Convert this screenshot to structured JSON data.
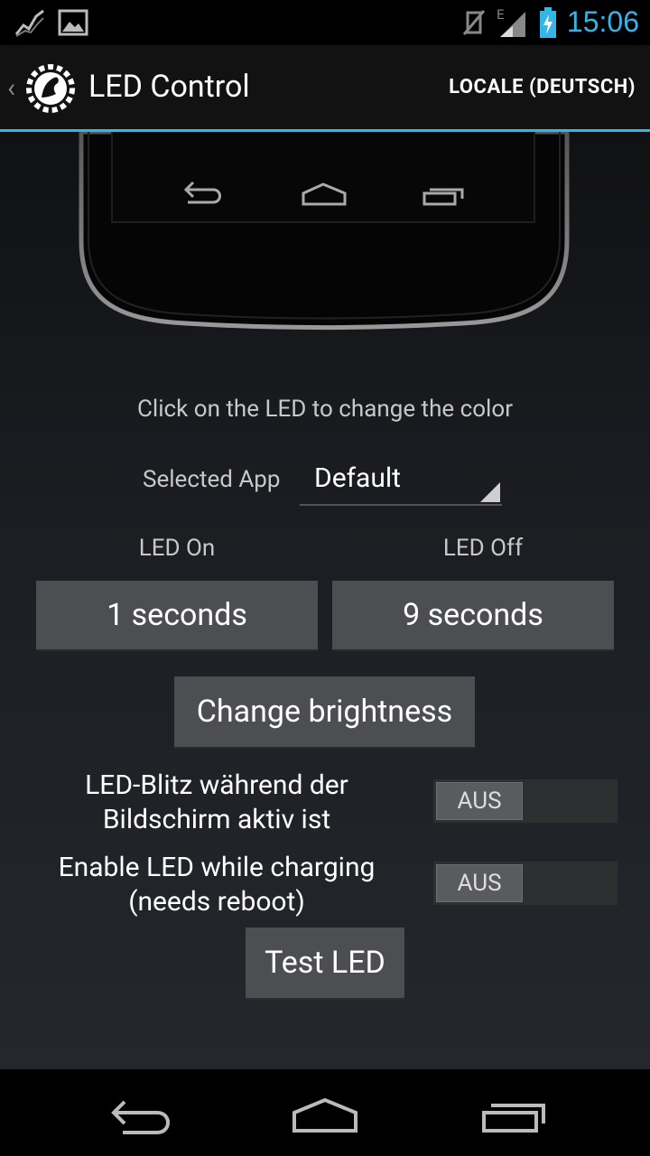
{
  "status_bar": {
    "time": "15:06",
    "network_type": "E",
    "icons": [
      "activity-graph-icon",
      "image-icon",
      "vibrate-muted-icon",
      "signal-icon",
      "battery-charging-icon"
    ]
  },
  "action_bar": {
    "title": "LED Control",
    "locale_button": "LOCALE (DEUTSCH)",
    "accent_color": "#33b5e5"
  },
  "main": {
    "hint": "Click on the LED to change the color",
    "selected_app_label": "Selected App",
    "selected_app_value": "Default",
    "led_on_label": "LED On",
    "led_off_label": "LED Off",
    "led_on_value": "1 seconds",
    "led_off_value": "9 seconds",
    "brightness_button": "Change brightness",
    "screen_on_label": "LED-Blitz während der Bildschirm aktiv ist",
    "screen_on_state": "AUS",
    "charging_label": "Enable LED while charging (needs reboot)",
    "charging_state": "AUS",
    "test_button": "Test LED"
  },
  "nav_bar": {
    "icons": [
      "back-icon",
      "home-icon",
      "recent-apps-icon"
    ]
  }
}
